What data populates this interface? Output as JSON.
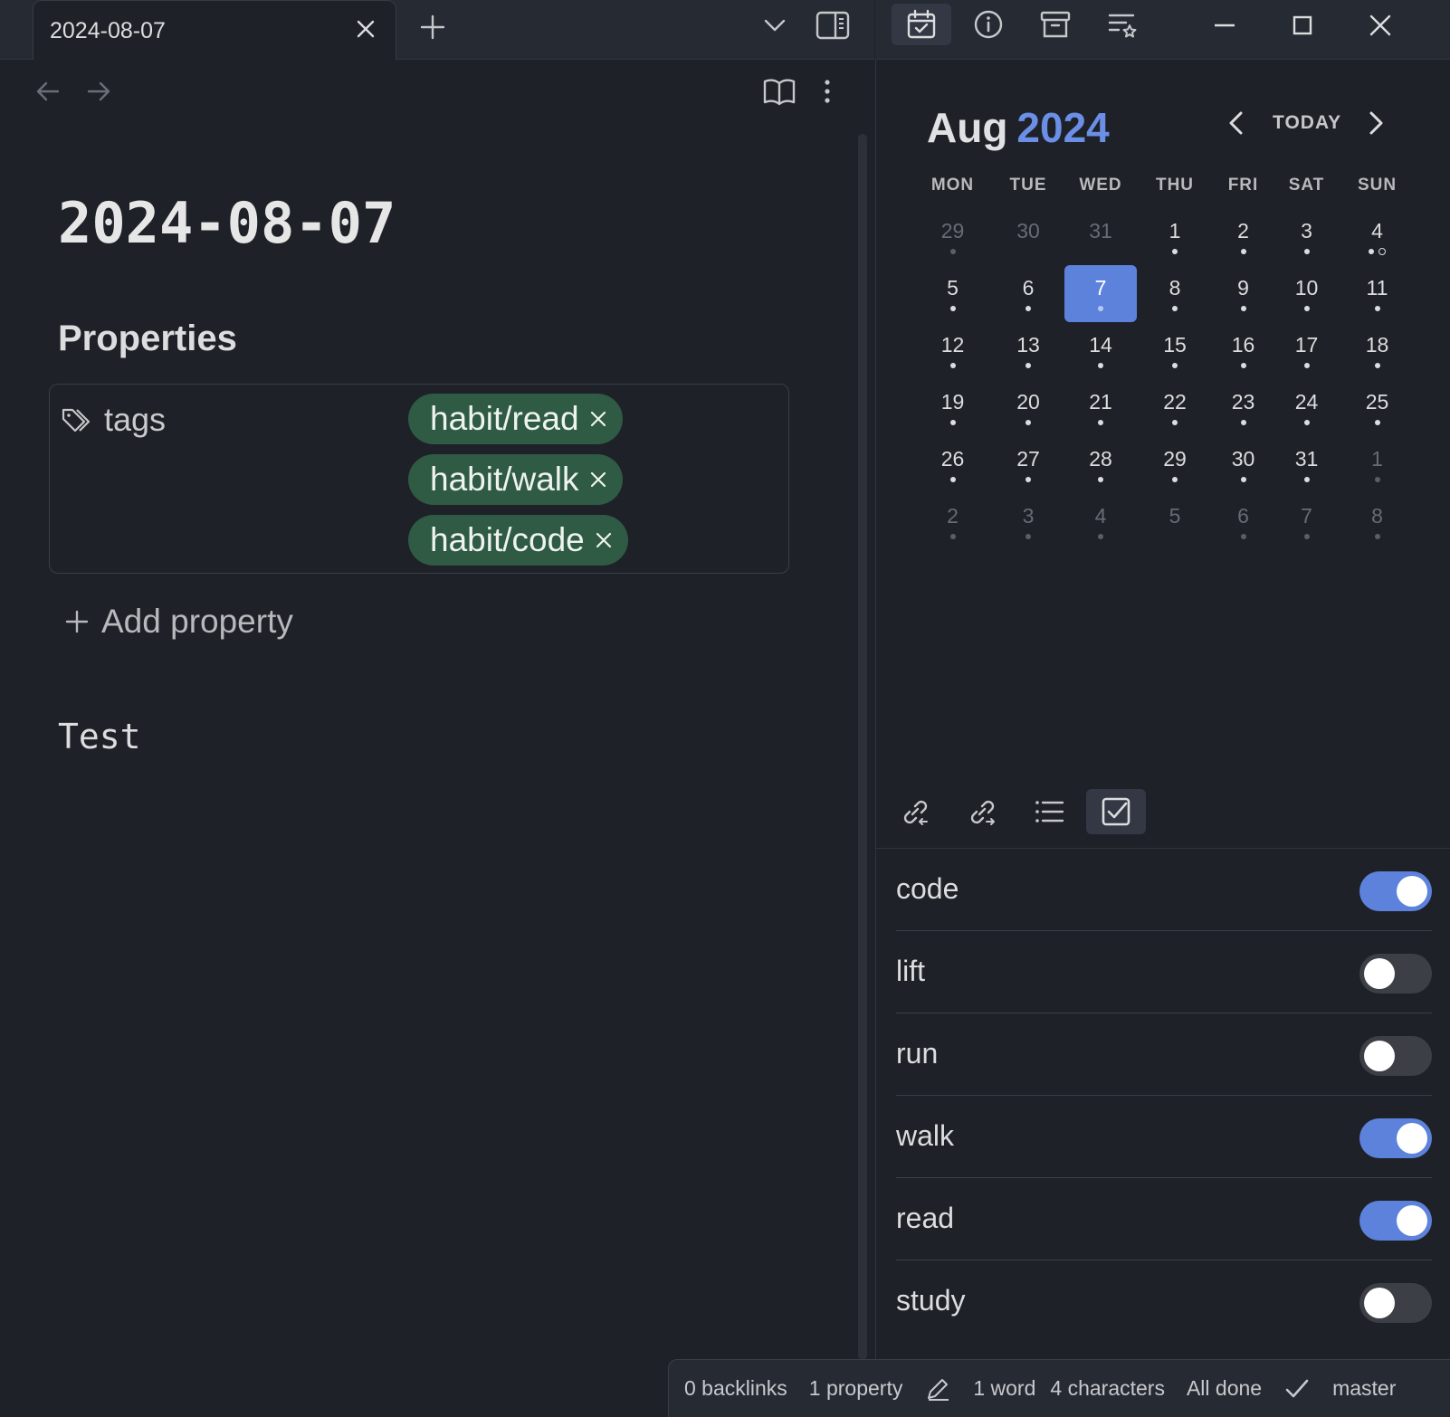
{
  "tab": {
    "title": "2024-08-07"
  },
  "icons": {
    "tab_close": "close-icon",
    "new_tab": "plus-icon",
    "tab_list": "chevron-down-icon",
    "sidebar_toggle": "sidebar-toggle-icon",
    "back": "arrow-left-icon",
    "forward": "arrow-right-icon",
    "reading_view": "book-open-icon",
    "more": "more-vertical-icon",
    "calendar": "calendar-check-icon",
    "info": "info-icon",
    "archive": "archive-icon",
    "list_star": "list-star-icon",
    "tags": "tags-icon",
    "backlinks": "link-incoming-icon",
    "outgoing": "link-outgoing-icon",
    "outline": "list-icon",
    "checkbox": "checkbox-icon",
    "edit": "pencil-icon",
    "sync": "check-icon"
  },
  "colors": {
    "accent": "#5d82dc",
    "tag_bg": "#2f5a44",
    "year": "#6b8ee6"
  },
  "note": {
    "title": "2024-08-07",
    "properties_heading": "Properties",
    "property_key": "tags",
    "tags": [
      "habit/read",
      "habit/walk",
      "habit/code"
    ],
    "add_property": "Add property",
    "body": "Test"
  },
  "calendar": {
    "month": "Aug",
    "year": "2024",
    "today_label": "TODAY",
    "weekdays": [
      "MON",
      "TUE",
      "WED",
      "THU",
      "FRI",
      "SAT",
      "SUN"
    ],
    "weeks": [
      [
        {
          "d": "29",
          "adj": true,
          "dots": 1
        },
        {
          "d": "30",
          "adj": true,
          "dots": 0
        },
        {
          "d": "31",
          "adj": true,
          "dots": 0
        },
        {
          "d": "1",
          "dots": 1
        },
        {
          "d": "2",
          "dots": 1
        },
        {
          "d": "3",
          "dots": 1
        },
        {
          "d": "4",
          "dots": 2,
          "hollow": 1
        }
      ],
      [
        {
          "d": "5",
          "dots": 1
        },
        {
          "d": "6",
          "dots": 1
        },
        {
          "d": "7",
          "dots": 1,
          "active": true
        },
        {
          "d": "8",
          "dots": 1
        },
        {
          "d": "9",
          "dots": 1
        },
        {
          "d": "10",
          "dots": 1
        },
        {
          "d": "11",
          "dots": 1
        }
      ],
      [
        {
          "d": "12",
          "dots": 1
        },
        {
          "d": "13",
          "dots": 1
        },
        {
          "d": "14",
          "dots": 1
        },
        {
          "d": "15",
          "dots": 1
        },
        {
          "d": "16",
          "dots": 1
        },
        {
          "d": "17",
          "dots": 1
        },
        {
          "d": "18",
          "dots": 1
        }
      ],
      [
        {
          "d": "19",
          "dots": 1
        },
        {
          "d": "20",
          "dots": 1
        },
        {
          "d": "21",
          "dots": 1
        },
        {
          "d": "22",
          "dots": 1
        },
        {
          "d": "23",
          "dots": 1
        },
        {
          "d": "24",
          "dots": 1
        },
        {
          "d": "25",
          "dots": 1
        }
      ],
      [
        {
          "d": "26",
          "dots": 1
        },
        {
          "d": "27",
          "dots": 1
        },
        {
          "d": "28",
          "dots": 1
        },
        {
          "d": "29",
          "dots": 1
        },
        {
          "d": "30",
          "dots": 1
        },
        {
          "d": "31",
          "dots": 1
        },
        {
          "d": "1",
          "adj": true,
          "dots": 1
        }
      ],
      [
        {
          "d": "2",
          "adj": true,
          "dots": 1
        },
        {
          "d": "3",
          "adj": true,
          "dots": 1
        },
        {
          "d": "4",
          "adj": true,
          "dots": 1
        },
        {
          "d": "5",
          "adj": true,
          "dots": 0
        },
        {
          "d": "6",
          "adj": true,
          "dots": 1
        },
        {
          "d": "7",
          "adj": true,
          "dots": 1
        },
        {
          "d": "8",
          "adj": true,
          "dots": 1
        }
      ]
    ]
  },
  "habits": [
    {
      "label": "code",
      "on": true
    },
    {
      "label": "lift",
      "on": false
    },
    {
      "label": "run",
      "on": false
    },
    {
      "label": "walk",
      "on": true
    },
    {
      "label": "read",
      "on": true
    },
    {
      "label": "study",
      "on": false
    }
  ],
  "status": {
    "backlinks": "0 backlinks",
    "properties": "1 property",
    "words": "1 word",
    "characters": "4 characters",
    "sync": "All done",
    "branch": "master"
  }
}
